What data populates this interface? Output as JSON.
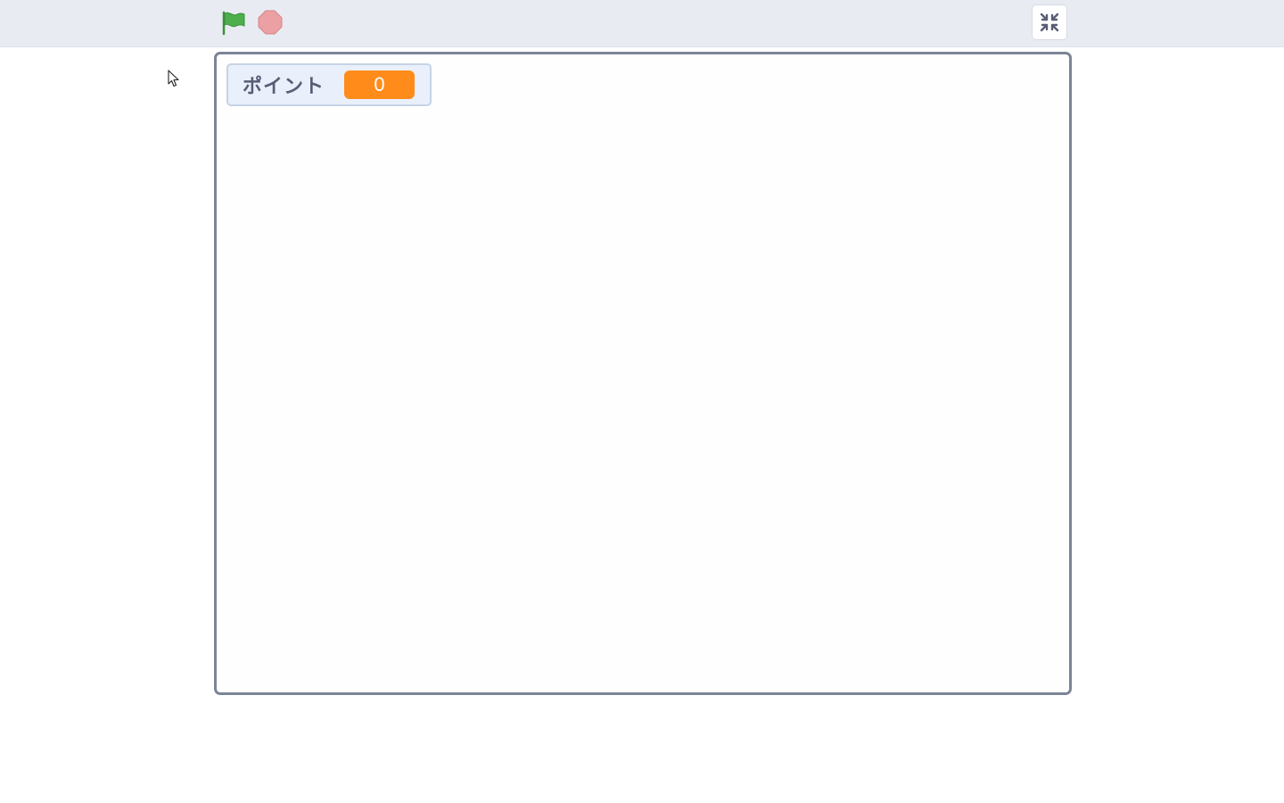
{
  "toolbar": {
    "green_flag_icon": "green-flag-icon",
    "stop_icon": "stop-sign-icon",
    "fullscreen_exit_icon": "exit-fullscreen-icon"
  },
  "stage": {
    "monitor": {
      "label": "ポイント",
      "value": "0"
    }
  },
  "colors": {
    "topbar_bg": "#e8ecf2",
    "green_flag": "#4cae4c",
    "stop": "#eba0a4",
    "monitor_bg": "#e9f0fb",
    "monitor_value_bg": "#ff8c1a",
    "stage_border": "#7c8596"
  }
}
